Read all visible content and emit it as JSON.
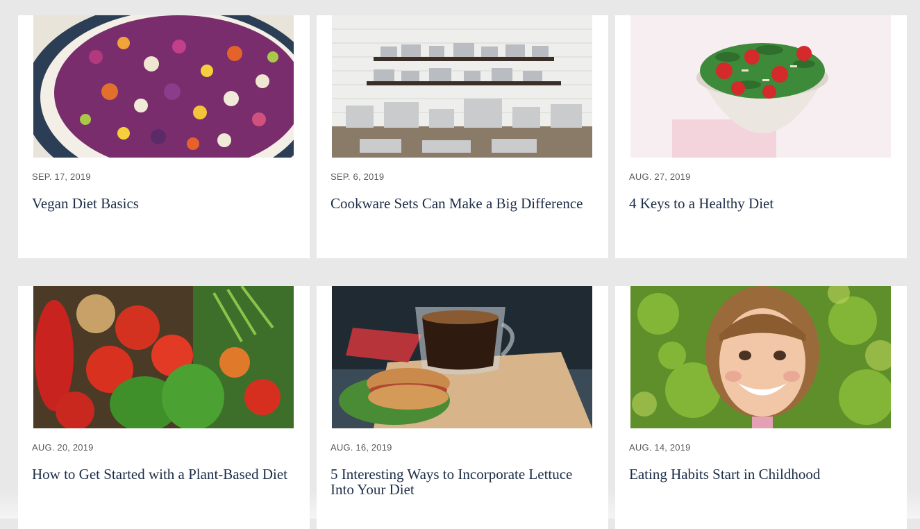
{
  "posts": [
    {
      "date": "SEP. 17, 2019",
      "title": "Vegan Diet Basics",
      "image": "coleslaw-bowl-image"
    },
    {
      "date": "SEP. 6, 2019",
      "title": "Cookware Sets Can Make a Big Difference",
      "image": "cookware-shelves-image"
    },
    {
      "date": "AUG. 27, 2019",
      "title": "4 Keys to a Healthy Diet",
      "image": "strawberry-salad-image"
    },
    {
      "date": "AUG. 20, 2019",
      "title": "How to Get Started with a Plant-Based Diet",
      "image": "vegetables-image"
    },
    {
      "date": "AUG. 16, 2019",
      "title": "5 Interesting Ways to Incorporate Lettuce Into Your Diet",
      "image": "sandwich-coffee-image"
    },
    {
      "date": "AUG. 14, 2019",
      "title": "Eating Habits Start in Childhood",
      "image": "smiling-child-image"
    }
  ],
  "colors": {
    "page_background": "#e8e8e8",
    "card_background": "#ffffff",
    "title": "#1c2d47",
    "date": "#555a5f"
  }
}
